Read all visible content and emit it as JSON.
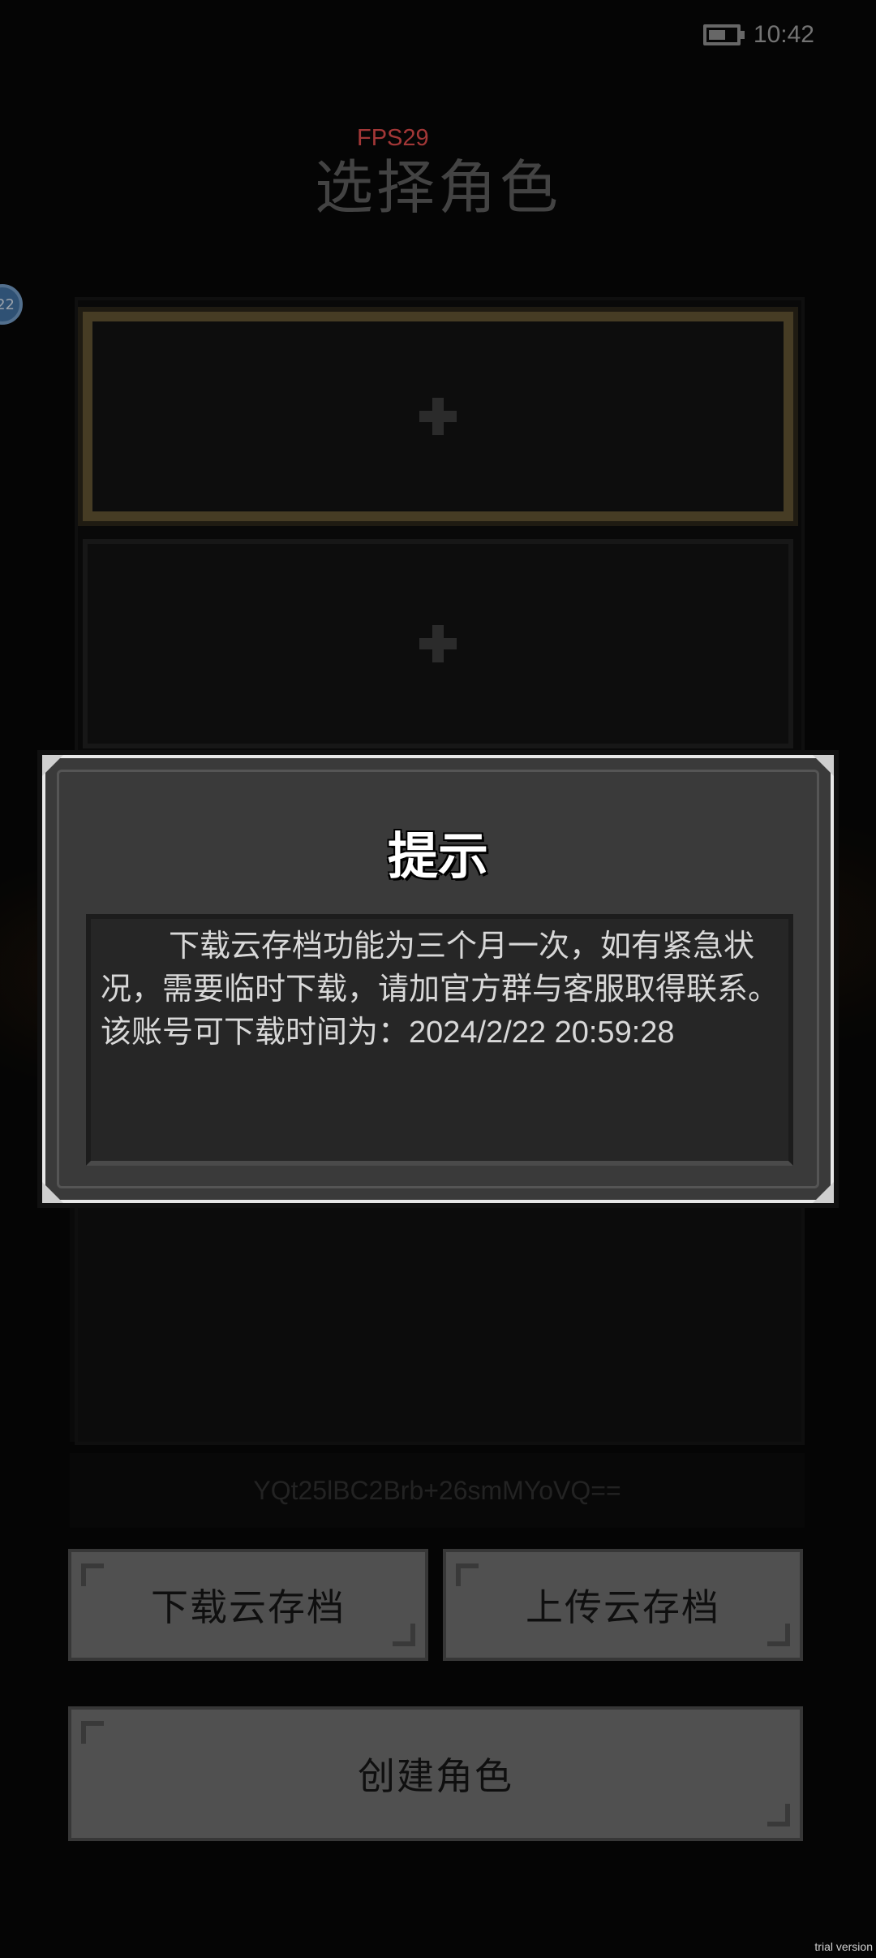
{
  "status_bar": {
    "time": "10:42",
    "battery_icon": "battery-icon"
  },
  "fps": "FPS29",
  "page_title": "选择角色",
  "side_badge": "22",
  "slots": [
    {
      "icon": "plus-icon",
      "selected": true
    },
    {
      "icon": "plus-icon",
      "selected": false
    }
  ],
  "cloud_code": "YQt25lBC2Brb+26smMYoVQ==",
  "buttons": {
    "download_cloud": "下载云存档",
    "upload_cloud": "上传云存档",
    "create_role": "创建角色"
  },
  "dialog": {
    "title": "提示",
    "message": "下载云存档功能为三个月一次，如有紧急状况，需要临时下载，请加官方群与客服取得联系。该账号可下载时间为：2024/2/22 20:59:28"
  },
  "watermark": "trial version",
  "colors": {
    "selected_border": "#5e5030",
    "fps": "#d94a4a",
    "badge": "#3f6c9b"
  }
}
